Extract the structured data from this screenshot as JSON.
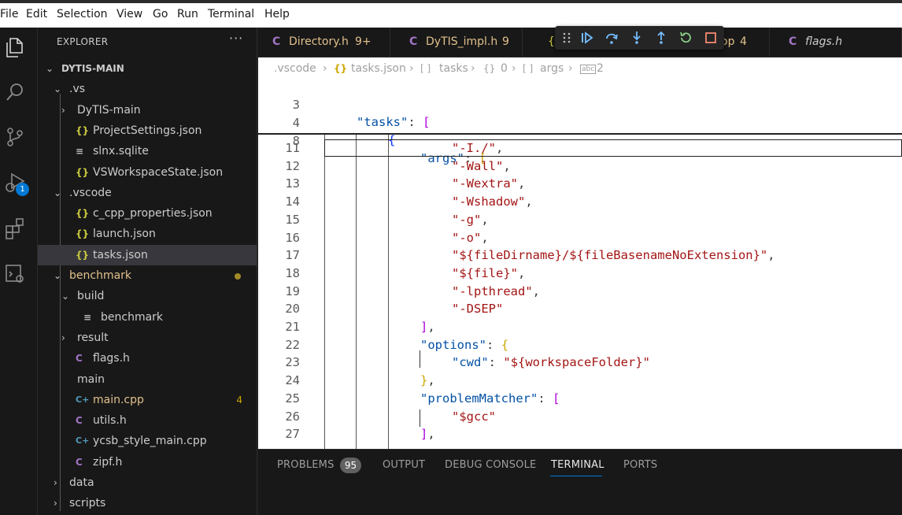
{
  "menu": [
    "File",
    "Edit",
    "Selection",
    "View",
    "Go",
    "Run",
    "Terminal",
    "Help"
  ],
  "activity": {
    "debug_badge": "1"
  },
  "explorer": {
    "title": "EXPLORER",
    "more": "···",
    "tree": [
      {
        "label": "DYTIS-MAIN",
        "chev": "⌄",
        "icon": "",
        "dec": ""
      },
      {
        "label": ".vs",
        "chev": "⌄",
        "icon": "",
        "dec": ""
      },
      {
        "label": "DyTIS-main",
        "chev": "›",
        "icon": "",
        "dec": ""
      },
      {
        "label": "ProjectSettings.json",
        "chev": "",
        "icon": "{}",
        "dec": ""
      },
      {
        "label": "slnx.sqlite",
        "chev": "",
        "icon": "≡",
        "dec": ""
      },
      {
        "label": "VSWorkspaceState.json",
        "chev": "",
        "icon": "{}",
        "dec": ""
      },
      {
        "label": ".vscode",
        "chev": "⌄",
        "icon": "",
        "dec": ""
      },
      {
        "label": "c_cpp_properties.json",
        "chev": "",
        "icon": "{}",
        "dec": ""
      },
      {
        "label": "launch.json",
        "chev": "",
        "icon": "{}",
        "dec": ""
      },
      {
        "label": "tasks.json",
        "chev": "",
        "icon": "{}",
        "dec": ""
      },
      {
        "label": "benchmark",
        "chev": "⌄",
        "icon": "",
        "dec": ""
      },
      {
        "label": "build",
        "chev": "⌄",
        "icon": "",
        "dec": ""
      },
      {
        "label": "benchmark",
        "chev": "",
        "icon": "≡",
        "dec": ""
      },
      {
        "label": "result",
        "chev": "›",
        "icon": "",
        "dec": ""
      },
      {
        "label": "flags.h",
        "chev": "",
        "icon": "C",
        "dec": ""
      },
      {
        "label": "main",
        "chev": "",
        "icon": "",
        "dec": ""
      },
      {
        "label": "main.cpp",
        "chev": "",
        "icon": "C+",
        "dec": "4"
      },
      {
        "label": "utils.h",
        "chev": "",
        "icon": "C",
        "dec": ""
      },
      {
        "label": "ycsb_style_main.cpp",
        "chev": "",
        "icon": "C+",
        "dec": ""
      },
      {
        "label": "zipf.h",
        "chev": "",
        "icon": "C",
        "dec": ""
      },
      {
        "label": "data",
        "chev": "›",
        "icon": "",
        "dec": ""
      },
      {
        "label": "scripts",
        "chev": "›",
        "icon": "",
        "dec": ""
      }
    ]
  },
  "tabs": [
    {
      "label": "Directory.h",
      "badge": "9+"
    },
    {
      "label": "DyTIS_impl.h",
      "badge": "9"
    },
    {
      "label": "op",
      "badge": "4"
    },
    {
      "label": "flags.h",
      "badge": ""
    }
  ],
  "breadcrumb": [
    ".vscode",
    "›",
    "{}",
    "tasks.json",
    "›",
    "[ ]",
    "tasks",
    "›",
    "{}",
    "0",
    "›",
    "[ ]",
    "args",
    "›",
    "abc",
    "2"
  ],
  "code": {
    "sticky": [
      {
        "n": "3",
        "t": "\"tasks\": ["
      },
      {
        "n": "4",
        "t": "{"
      },
      {
        "n": "8",
        "t": "\"args\": ["
      }
    ],
    "lines": [
      {
        "n": "11",
        "t": "\"-I./\","
      },
      {
        "n": "12",
        "t": "\"-Wall\","
      },
      {
        "n": "13",
        "t": "\"-Wextra\","
      },
      {
        "n": "14",
        "t": "\"-Wshadow\","
      },
      {
        "n": "15",
        "t": "\"-g\","
      },
      {
        "n": "16",
        "t": "\"-o\","
      },
      {
        "n": "17",
        "t": "\"${fileDirname}/${fileBasenameNoExtension}\","
      },
      {
        "n": "18",
        "t": "\"${file}\","
      },
      {
        "n": "19",
        "t": "\"-lpthread\","
      },
      {
        "n": "20",
        "t": "\"-DSEP\""
      },
      {
        "n": "21",
        "t": "],"
      },
      {
        "n": "22",
        "t": "\"options\": {"
      },
      {
        "n": "23",
        "t": "\"cwd\": \"${workspaceFolder}\""
      },
      {
        "n": "24",
        "t": "},"
      },
      {
        "n": "25",
        "t": "\"problemMatcher\": ["
      },
      {
        "n": "26",
        "t": "\"$gcc\""
      },
      {
        "n": "27",
        "t": "],"
      }
    ]
  },
  "panel": {
    "tabs": [
      "PROBLEMS",
      "OUTPUT",
      "DEBUG CONSOLE",
      "TERMINAL",
      "PORTS"
    ],
    "problems_count": "95",
    "active": "TERMINAL"
  }
}
